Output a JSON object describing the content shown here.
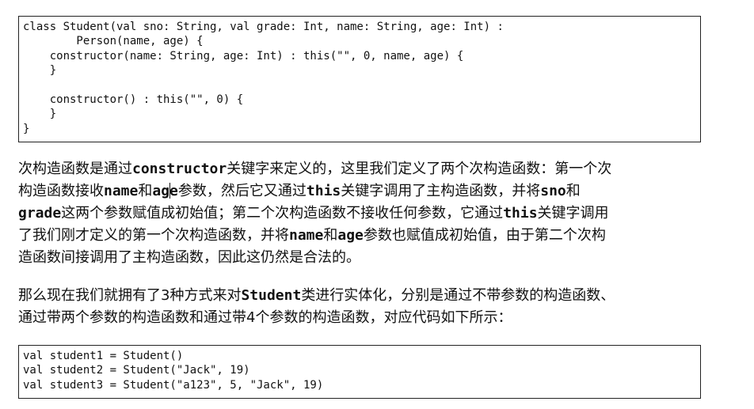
{
  "code_block_1": {
    "lines": [
      "class Student(val sno: String, val grade: Int, name: String, age: Int) :",
      "        Person(name, age) {",
      "    constructor(name: String, age: Int) : this(\"\", 0, name, age) {",
      "    }",
      "",
      "    constructor() : this(\"\", 0) {",
      "    }",
      "}"
    ]
  },
  "paragraph_1": {
    "l1_a": "次构造函数是通过",
    "l1_b": "constructor",
    "l1_c": "关键字来定义的，这里我们定义了两个次构造函数：第一个次",
    "l2_a": "构造函数接收",
    "l2_b": "name",
    "l2_c": "和",
    "l2_d": "ag",
    "l2_e": "e",
    "l2_f": "参数，然后它又通过",
    "l2_g": "this",
    "l2_h": "关键字调用了主构造函数，并将",
    "l2_i": "sno",
    "l2_j": "和",
    "l3_a": "grade",
    "l3_b": "这两个参数赋值成初始值；第二个次构造函数不接收任何参数，它通过",
    "l3_c": "this",
    "l3_d": "关键字调用",
    "l4_a": "了我们刚才定义的第一个次构造函数，并将",
    "l4_b": "name",
    "l4_c": "和",
    "l4_d": "age",
    "l4_e": "参数也赋值成初始值，由于第二个次构",
    "l5_a": "造函数间接调用了主构造函数，因此这仍然是合法的。"
  },
  "paragraph_2": {
    "l1_a": "那么现在我们就拥有了3种方式来对",
    "l1_b": "Student",
    "l1_c": "类进行实体化，分别是通过不带参数的构造函数、",
    "l2_a": "通过带两个参数的构造函数和通过带4个参数的构造函数，对应代码如下所示："
  },
  "code_block_2": {
    "lines": [
      "val student1 = Student()",
      "val student2 = Student(\"Jack\", 19)",
      "val student3 = Student(\"a123\", 5, \"Jack\", 19)"
    ]
  }
}
